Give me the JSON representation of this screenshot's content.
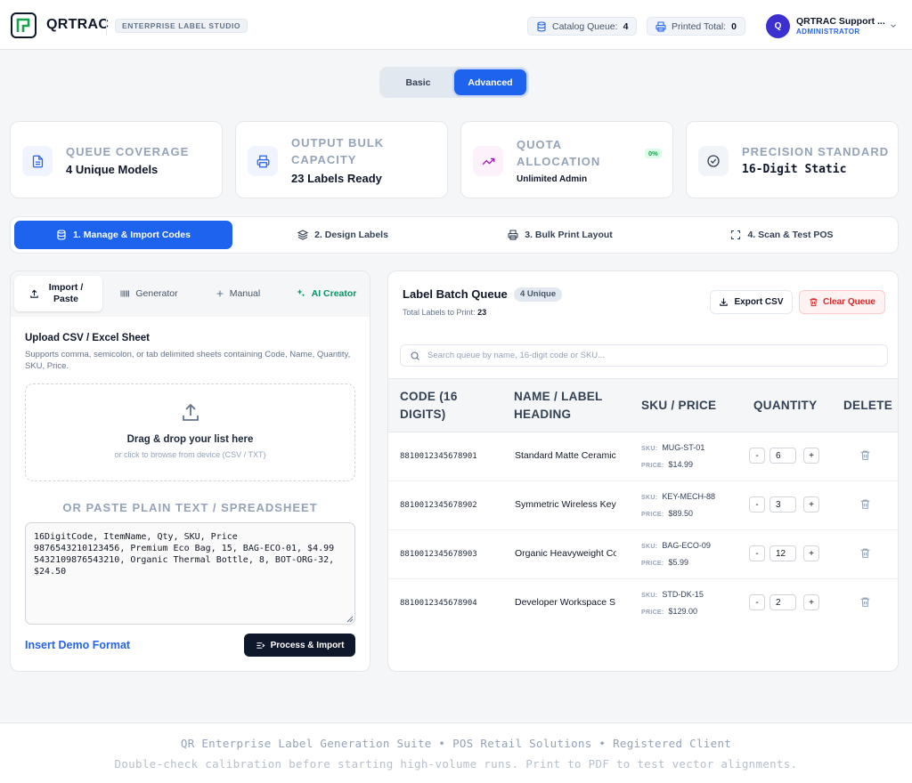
{
  "header": {
    "brand": "QRTRAC",
    "studio_badge": "ENTERPRISE LABEL STUDIO",
    "catalog_queue_label": "Catalog Queue:",
    "catalog_queue_value": "4",
    "printed_total_label": "Printed Total:",
    "printed_total_value": "0",
    "avatar_initial": "Q",
    "user_name": "QRTRAC Support ...",
    "user_role": "ADMINISTRATOR"
  },
  "mode_toggle": {
    "basic": "Basic",
    "advanced": "Advanced",
    "selected": "Advanced"
  },
  "stats": [
    {
      "label": "QUEUE COVERAGE",
      "value": "4 Unique Models",
      "icon": "document-list-icon"
    },
    {
      "label_line1": "OUTPUT BULK",
      "label_line2": "CAPACITY",
      "value": "23 Labels Ready",
      "icon": "printer-icon"
    },
    {
      "label_line1": "QUOTA",
      "label_line2": "ALLOCATION",
      "value": "Unlimited Admin",
      "badge": "0%",
      "icon": "trend-up-icon"
    },
    {
      "label": "PRECISION STANDARD",
      "value": "16-Digit Static",
      "icon": "check-circle-icon"
    }
  ],
  "steps": [
    {
      "label": "1. Manage & Import Codes",
      "active": true
    },
    {
      "label": "2. Design Labels",
      "active": false
    },
    {
      "label": "3. Bulk Print Layout",
      "active": false
    },
    {
      "label": "4. Scan & Test POS",
      "active": false
    }
  ],
  "import_panel": {
    "tabs": [
      {
        "label": "Import / Paste"
      },
      {
        "label": "Generator"
      },
      {
        "label": "Manual"
      },
      {
        "label": "AI Creator"
      }
    ],
    "title": "Upload CSV / Excel Sheet",
    "description": "Supports comma, semicolon, or tab delimited sheets containing Code, Name, Quantity, SKU, Price.",
    "dropzone_title": "Drag & drop your list here",
    "dropzone_sub": "or click to browse from device (CSV / TXT)",
    "or_paste": "OR PASTE PLAIN TEXT / SPREADSHEET",
    "textarea_value": "16DigitCode, ItemName, Qty, SKU, Price\n9876543210123456, Premium Eco Bag, 15, BAG-ECO-01, $4.99\n5432109876543210, Organic Thermal Bottle, 8, BOT-ORG-32, $24.50",
    "demo_link": "Insert Demo Format",
    "process_button": "Process & Import"
  },
  "queue": {
    "title": "Label Batch Queue",
    "unique_badge": "4 Unique",
    "total_label": "Total Labels to Print:",
    "total_value": "23",
    "export_button": "Export CSV",
    "clear_button": "Clear Queue",
    "search_placeholder": "Search queue by name, 16-digit code or SKU...",
    "columns": {
      "code_l1": "CODE (16",
      "code_l2": "DIGITS)",
      "name_l1": "NAME / LABEL",
      "name_l2": "HEADING",
      "sku": "SKU / PRICE",
      "quantity": "QUANTITY",
      "delete": "DELETE"
    },
    "sku_tag": "SKU:",
    "price_tag": "PRICE:",
    "rows": [
      {
        "code": "8810012345678901",
        "name": "Standard Matte Ceramic",
        "sku": "MUG-ST-01",
        "price": "$14.99",
        "qty": "6"
      },
      {
        "code": "8810012345678902",
        "name": "Symmetric Wireless Key",
        "sku": "KEY-MECH-88",
        "price": "$89.50",
        "qty": "3"
      },
      {
        "code": "8810012345678903",
        "name": "Organic Heavyweight Co",
        "sku": "BAG-ECO-09",
        "price": "$5.99",
        "qty": "12"
      },
      {
        "code": "8810012345678904",
        "name": "Developer Workspace S",
        "sku": "STD-DK-15",
        "price": "$129.00",
        "qty": "2"
      }
    ]
  },
  "footer": {
    "line1": "QR Enterprise Label Generation Suite • POS Retail Solutions • Registered Client",
    "line2": "Double-check calibration before starting high-volume runs. Print to PDF to test vector alignments."
  },
  "colors": {
    "accent": "#1d63ed",
    "dark": "#0f172a",
    "danger": "#dc2626",
    "success": "#16a34a",
    "ai": "#059669"
  }
}
